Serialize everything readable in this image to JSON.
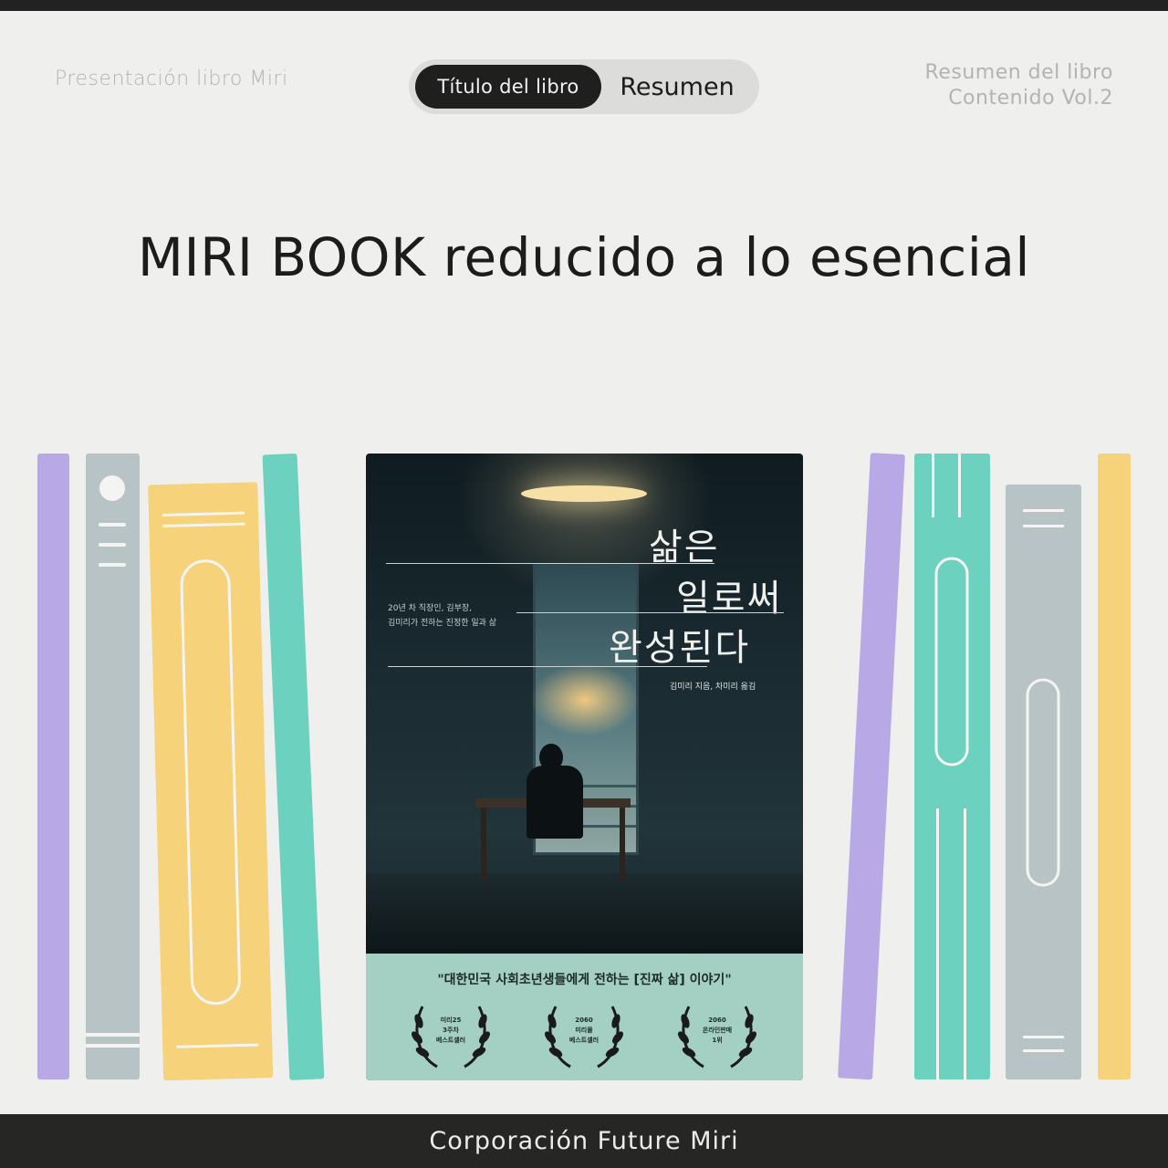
{
  "header": {
    "left_label": "Presentación libro Miri",
    "right_line1": "Resumen del libro",
    "right_line2": "Contenido Vol.2"
  },
  "toggle": {
    "active_label": "Título del libro",
    "inactive_label": "Resumen"
  },
  "headline": "MIRI BOOK reducido a lo esencial",
  "book": {
    "title_line1": "삶은",
    "title_line2": "일로써",
    "title_line3": "완성된다",
    "subtitle_line1": "20년 차 직장인, 김부장,",
    "subtitle_line2": "김미리가 전하는 진정한 일과 삶",
    "author": "김미리 지음, 차미리 옮김",
    "quote": "\"대한민국 사회초년생들에게 전하는 [진짜 삶] 이야기\"",
    "awards": [
      {
        "line1": "미리25",
        "line2": "3주차",
        "line3": "베스트셀러"
      },
      {
        "line1": "2060",
        "line2": "미리몰",
        "line3": "베스트셀러"
      },
      {
        "line1": "2060",
        "line2": "온라인판매",
        "line3": "1위"
      }
    ]
  },
  "colors": {
    "lavender": "#b9a8e6",
    "gray_blue": "#b8c3c6",
    "yellow": "#f6d27b",
    "teal": "#6cd2bf",
    "background": "#efefed",
    "dark": "#222222"
  },
  "footer": {
    "label": "Corporación Future Miri"
  }
}
